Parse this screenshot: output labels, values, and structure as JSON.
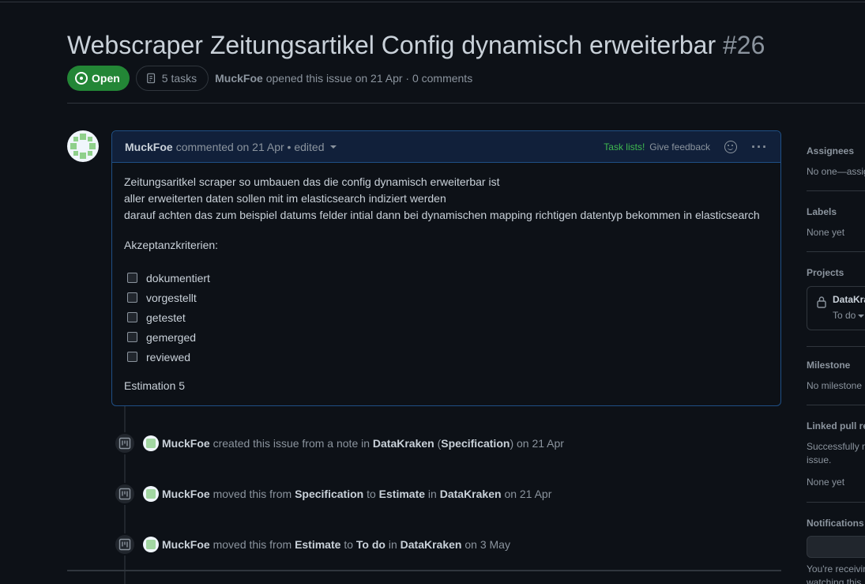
{
  "issue": {
    "title": "Webscraper Zeitungsartikel Config dynamisch erweiterbar",
    "number": "#26",
    "state": "Open",
    "tasks": "5 tasks",
    "author": "MuckFoe",
    "meta": "opened this issue on 21 Apr · 0 comments"
  },
  "comment": {
    "author": "MuckFoe",
    "action": "commented on 21 Apr • edited",
    "task_lists_label": "Task lists!",
    "feedback_label": "Give feedback",
    "body": [
      "Zeitungsaritkel scraper so umbauen das die config dynamisch erweiterbar ist",
      "aller erweiterten daten sollen mit im elasticsearch indiziert werden",
      "darauf achten das zum beispiel datums felder intial dann bei dynamischen mapping richtigen datentyp bekommen in elasticsearch"
    ],
    "criteria_heading": "Akzeptanzkriterien:",
    "tasks": [
      "dokumentiert",
      "vorgestellt",
      "getestet",
      "gemerged",
      "reviewed"
    ],
    "estimation": "Estimation 5"
  },
  "timeline": [
    {
      "actor": "MuckFoe",
      "t1": "created this issue from a note in",
      "b1": "DataKraken",
      "t2": "(",
      "b2": "Specification",
      "t3": ") on 21 Apr"
    },
    {
      "actor": "MuckFoe",
      "t1": "moved this from",
      "b1": "Specification",
      "t2": "to",
      "b2": "Estimate",
      "t3": "in",
      "b3": "DataKraken",
      "t4": "on 21 Apr"
    },
    {
      "actor": "MuckFoe",
      "t1": "moved this from",
      "b1": "Estimate",
      "t2": "to",
      "b2": "To do",
      "t3": "in",
      "b3": "DataKraken",
      "t4": "on 3 May"
    }
  ],
  "sidebar": {
    "assignees_label": "Assignees",
    "assignees_value": "No one—assig",
    "labels_label": "Labels",
    "labels_value": "None yet",
    "projects_label": "Projects",
    "project_name": "DataKra",
    "project_column": "To do",
    "milestone_label": "Milestone",
    "milestone_value": "No milestone",
    "linked_label": "Linked pull re",
    "linked_desc_1": "Successfully m",
    "linked_desc_2": "issue.",
    "linked_value": "None yet",
    "notifications_label": "Notifications",
    "notif_text_1": "You're receivin",
    "notif_text_2": "watching this"
  },
  "colors": {
    "background": "#0d1117",
    "open_badge": "#238636",
    "accent_border": "#1f4f86",
    "task_lists_green": "#3fb950"
  },
  "icons": [
    "issue-open-icon",
    "checklist-icon",
    "smiley-icon",
    "kebab-icon",
    "project-icon",
    "lock-icon"
  ]
}
